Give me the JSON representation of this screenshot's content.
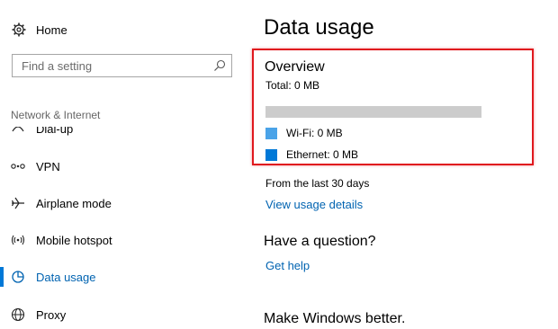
{
  "sidebar": {
    "home_label": "Home",
    "search_placeholder": "Find a setting",
    "section_header": "Network & Internet",
    "items": [
      {
        "label": "Dial-up",
        "icon": "dial-up-icon"
      },
      {
        "label": "VPN",
        "icon": "vpn-icon"
      },
      {
        "label": "Airplane mode",
        "icon": "airplane-icon"
      },
      {
        "label": "Mobile hotspot",
        "icon": "hotspot-icon"
      },
      {
        "label": "Data usage",
        "icon": "data-usage-icon",
        "active": true
      },
      {
        "label": "Proxy",
        "icon": "globe-icon"
      }
    ]
  },
  "main": {
    "title": "Data usage",
    "overview": {
      "title": "Overview",
      "total": "Total: 0 MB",
      "legend": [
        {
          "label": "Wi-Fi: 0 MB",
          "color": "#4aa3e8"
        },
        {
          "label": "Ethernet: 0 MB",
          "color": "#0078d7"
        }
      ]
    },
    "from_text": "From the last 30 days",
    "view_details_link": "View usage details",
    "question_heading": "Have a question?",
    "get_help_link": "Get help",
    "better_heading": "Make Windows better."
  },
  "colors": {
    "accent": "#0078d7",
    "link": "#0063b1",
    "highlight_border": "#e0191e",
    "bar_empty": "#cccccc"
  }
}
